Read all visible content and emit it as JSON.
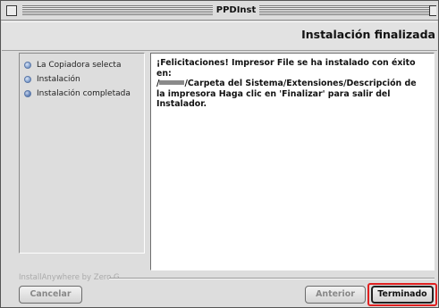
{
  "window": {
    "title": "PPDInst"
  },
  "header": {
    "title": "Instalación finalizada"
  },
  "steps": [
    {
      "label": "La Copiadora selecta",
      "icon": "step-bullet-icon"
    },
    {
      "label": "Instalación",
      "icon": "step-bullet-icon"
    },
    {
      "label": "Instalación completada",
      "icon": "step-bullet-icon"
    }
  ],
  "message": {
    "line1": "¡Felicitaciones! Impresor File se ha instalado con éxito en:",
    "line2_prefix": "/",
    "line2_rest": "/Carpeta del Sistema/Extensiones/Descripción de",
    "line3": "la impresora Haga clic en 'Finalizar' para salir del",
    "line4": "Instalador."
  },
  "footer": {
    "branding": "InstallAnywhere by Zero G",
    "cancel_label": "Cancelar",
    "back_label": "Anterior",
    "done_label": "Terminado"
  },
  "colors": {
    "highlight_ring": "#e02020",
    "bullet": "#6e8cbf"
  }
}
